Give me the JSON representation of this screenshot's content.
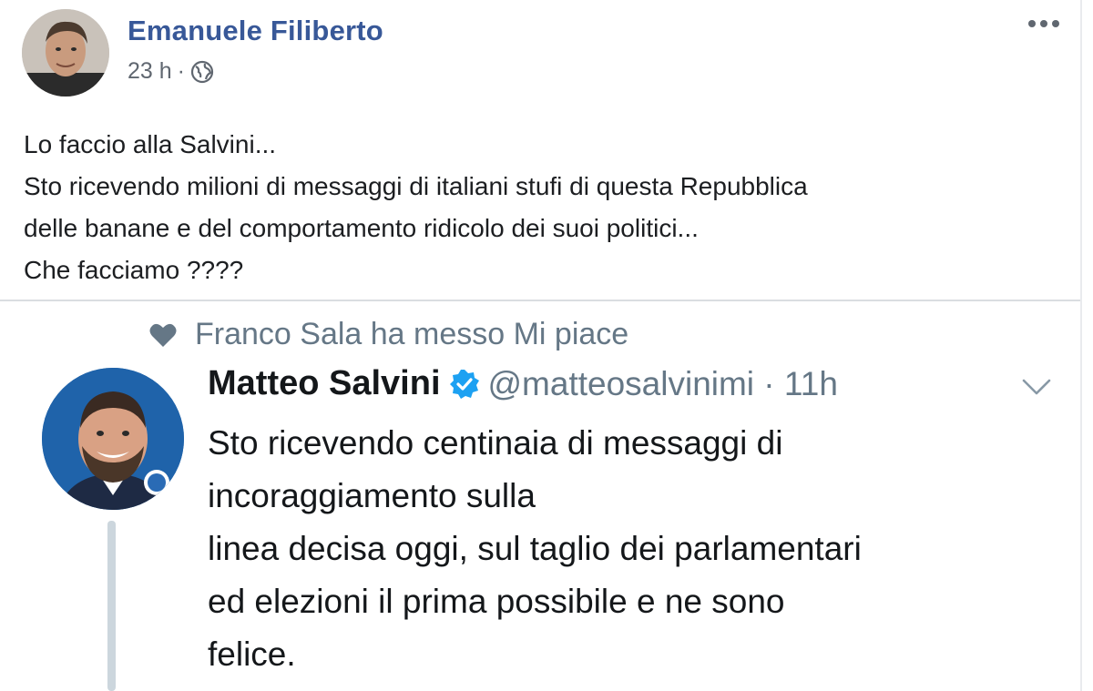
{
  "post": {
    "author": "Emanuele Filiberto",
    "time": "23 h",
    "separator": "·",
    "text_lines": [
      "Lo faccio alla Salvini...",
      "Sto ricevendo milioni di messaggi di italiani stufi di questa Repubblica",
      "delle banane e del comportamento ridicolo dei suoi politici...",
      "Che facciamo ????"
    ]
  },
  "tweet": {
    "like_note": "Franco Sala ha messo Mi piace",
    "name": "Matteo Salvini",
    "handle_time": "@matteosalvinimi · 11h",
    "text_lines": [
      "Sto ricevendo centinaia di messaggi di",
      "incoraggiamento sulla",
      "linea decisa oggi, sul taglio dei parlamentari",
      "ed elezioni il prima possibile e ne sono",
      "felice."
    ]
  },
  "colors": {
    "facebook_link": "#385898",
    "twitter_verified": "#1da1f2",
    "muted_text": "#657786"
  },
  "icons": [
    "globe-icon",
    "more-options-icon",
    "heart-icon",
    "verified-badge-icon",
    "chevron-down-icon"
  ]
}
